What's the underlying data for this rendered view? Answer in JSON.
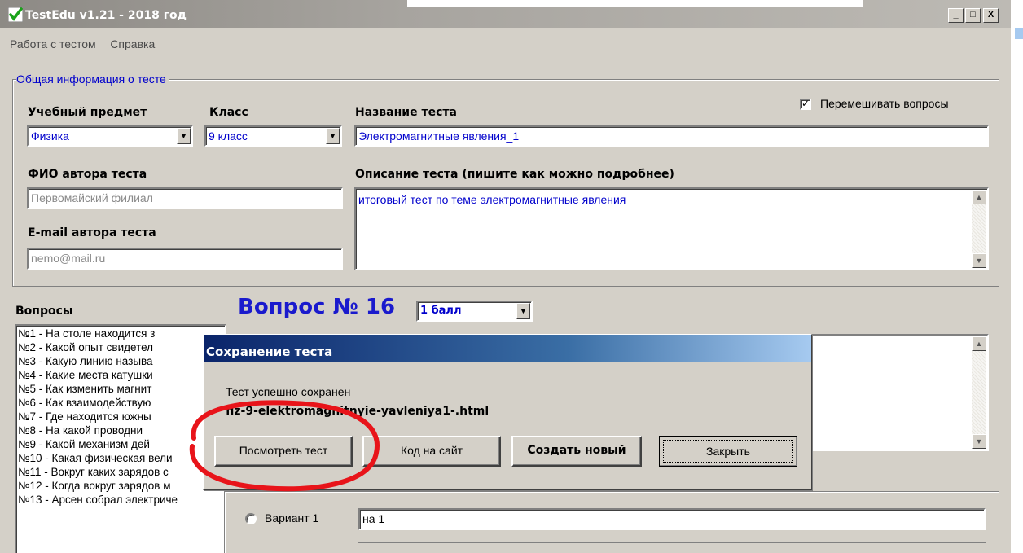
{
  "window": {
    "title": "TestEdu v1.21 - 2018 год",
    "controls": {
      "minimize": "_",
      "maximize": "□",
      "close": "X"
    }
  },
  "menu": [
    "Работа с тестом",
    "Справка"
  ],
  "general_info": {
    "legend": "Общая информация о тесте",
    "subject_label": "Учебный предмет",
    "subject_value": "Физика",
    "grade_label": "Класс",
    "grade_value": "9 класс",
    "test_name_label": "Название теста",
    "test_name_value": "Электромагнитные явления_1",
    "shuffle_label": "Перемешивать вопросы",
    "shuffle_checked": true,
    "author_label": "ФИО автора теста",
    "author_value": "Первомайский филиал",
    "email_label": "E-mail автора теста",
    "email_value": "nemo@mail.ru",
    "description_label": "Описание теста (пишите как можно подробнее)",
    "description_value": "итоговый тест по теме электромагнитные явления"
  },
  "questions": {
    "label": "Вопросы",
    "items": [
      "№1 - На столе находится з",
      "№2 - Какой опыт свидетел",
      "№3 - Какую линию называ",
      "№4 - Какие места катушки",
      "№5 - Как изменить магнит",
      "№6 - Как взаимодействую",
      "№7 - Где находится южны",
      "№8 - На какой проводни",
      "№9 - Какой механизм дей",
      "№10 - Какая физическая вели",
      "№11 - Вокруг каких зарядов с",
      "№12 - Когда вокруг зарядов м",
      "№13 - Арсен собрал электриче"
    ]
  },
  "question": {
    "title": "Вопрос № 16",
    "points": "1 балл"
  },
  "answers": [
    {
      "label": "Вариант 1",
      "value": "на 1"
    }
  ],
  "dialog": {
    "title": "Сохранение теста",
    "message": "Тест успешно сохранен",
    "filename": "fiz-9-elektromagnitnyie-yavleniya1-.html",
    "buttons": {
      "view": "Посмотреть тест",
      "code": "Код на сайт",
      "new": "Создать новый",
      "close": "Закрыть"
    }
  },
  "colors": {
    "window_bg": "#d4d0c8",
    "title_blue": "#0a246a",
    "link_blue": "#0000cc",
    "annotation_red": "#e8141a"
  },
  "icons": {
    "app": "green-check-icon",
    "dropdown": "chevron-down-icon",
    "scroll_up": "scroll-up-icon",
    "scroll_down": "scroll-down-icon"
  }
}
